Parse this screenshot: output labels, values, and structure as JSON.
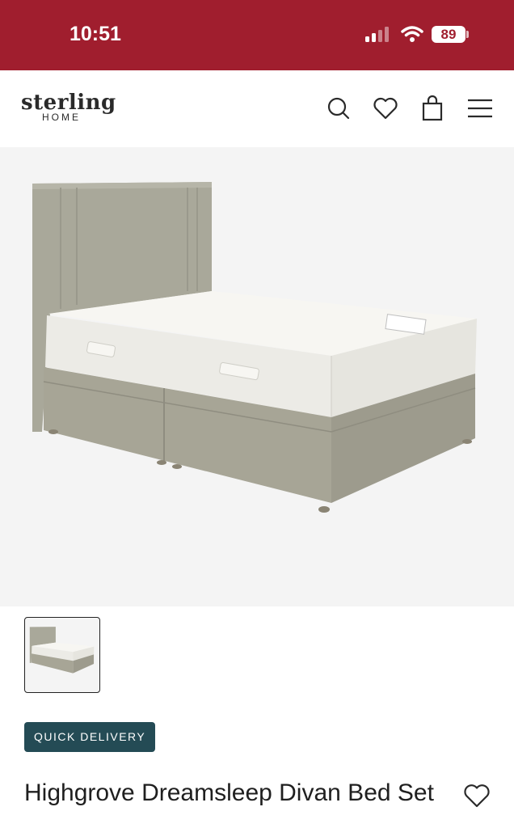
{
  "status_bar": {
    "time": "10:51",
    "battery": "89",
    "bg_color": "#a01e2e"
  },
  "header": {
    "logo_main": "sterling",
    "logo_sub": "HOME",
    "icons": [
      "search-icon",
      "heart-icon",
      "shopping-bag-icon",
      "menu-icon"
    ]
  },
  "product": {
    "badge": "QUICK DELIVERY",
    "badge_color": "#244b55",
    "title": "Highgrove Dreamsleep Divan Bed Set"
  }
}
